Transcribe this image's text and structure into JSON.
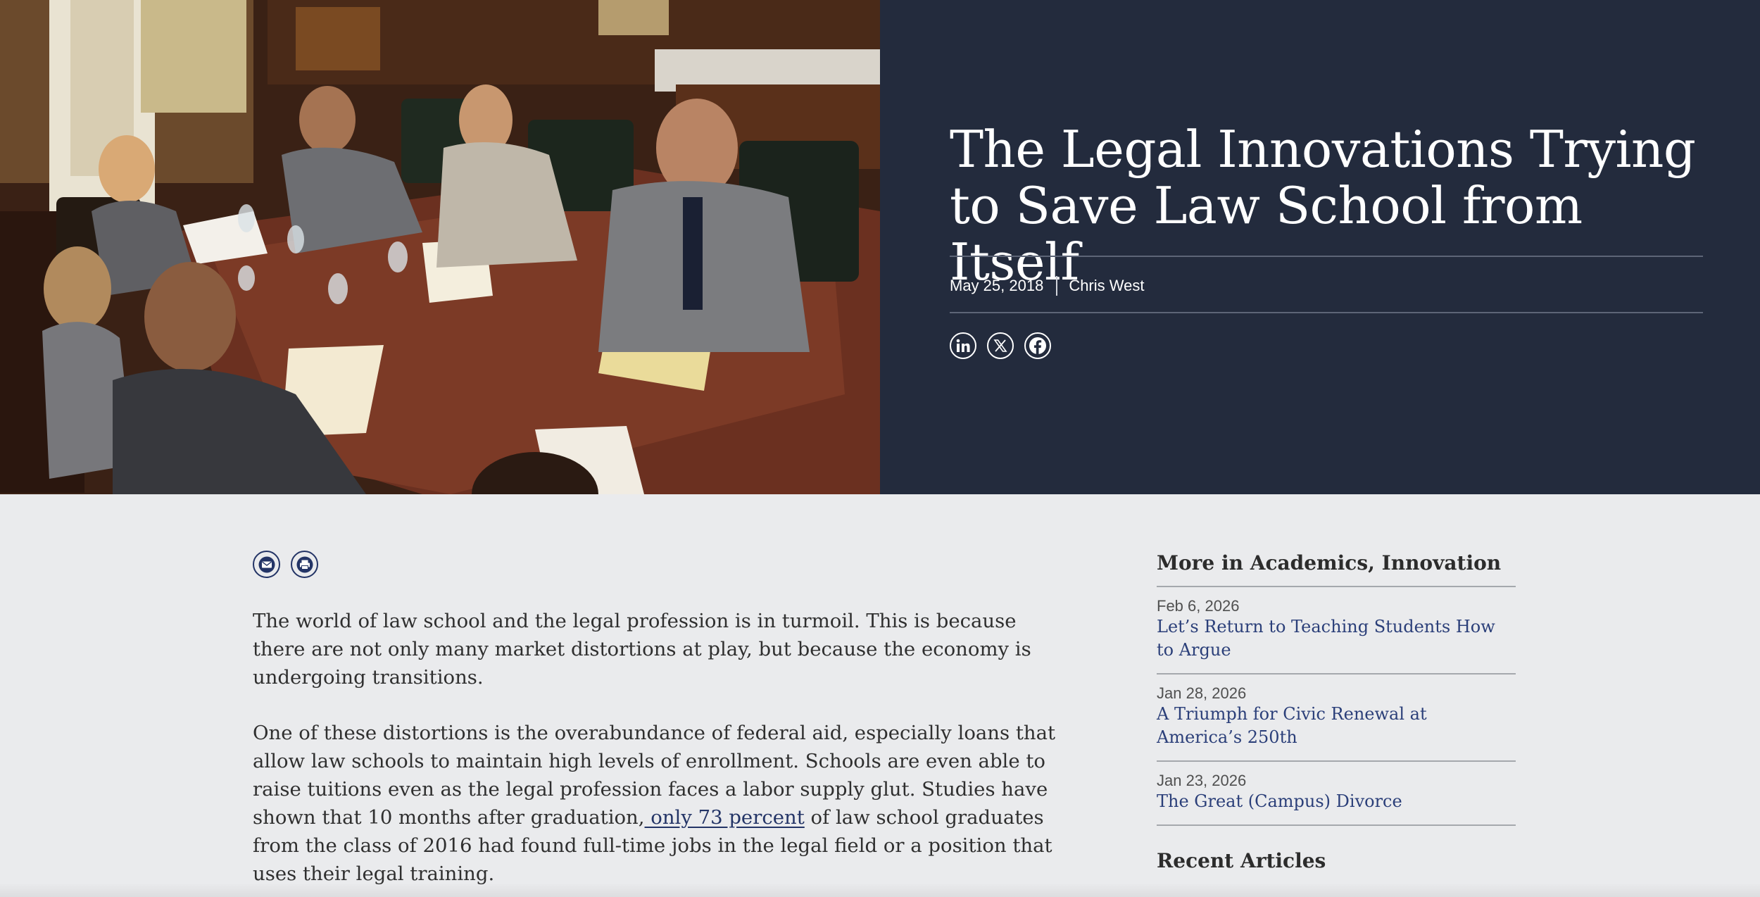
{
  "hero": {
    "image_alt": "Lawyers meeting around a conference table",
    "title": "The Legal Innovations Trying to Save Law School from Itself",
    "date": "May 25, 2018",
    "author": "Chris West",
    "social_icons": [
      "linkedin-icon",
      "x-icon",
      "facebook-icon"
    ]
  },
  "tools": {
    "icons": [
      "email-icon",
      "print-icon"
    ]
  },
  "article": {
    "p1": "The world of law school and the legal profession is in turmoil. This is because there are not only many market distortions at play, but because the economy is undergoing transitions.",
    "p2_before": "One of these distortions is the overabundance of federal aid, especially loans that allow law schools to maintain high levels of enrollment. Schools are even able to raise tuitions even as the legal profession faces a labor supply glut. Studies have shown that 10 months after graduation,",
    "p2_link": " only 73 percent",
    "p2_after": " of law school graduates from the class of 2016 had found full-time jobs in the legal field or a position that uses their legal training."
  },
  "sidebar": {
    "heading": "More in Academics, Innovation",
    "items": [
      {
        "date": "Feb 6, 2026",
        "title": "Let’s Return to Teaching Students How to Argue"
      },
      {
        "date": "Jan 28, 2026",
        "title": "A Triumph for Civic Renewal at America’s 250th"
      },
      {
        "date": "Jan 23, 2026",
        "title": "The Great (Campus) Divorce"
      }
    ],
    "recent_heading": "Recent Articles"
  },
  "colors": {
    "hero_panel": "#232b3d",
    "page_bg": "#eaebed",
    "link": "#2b3f79",
    "icon_border": "#233466"
  }
}
